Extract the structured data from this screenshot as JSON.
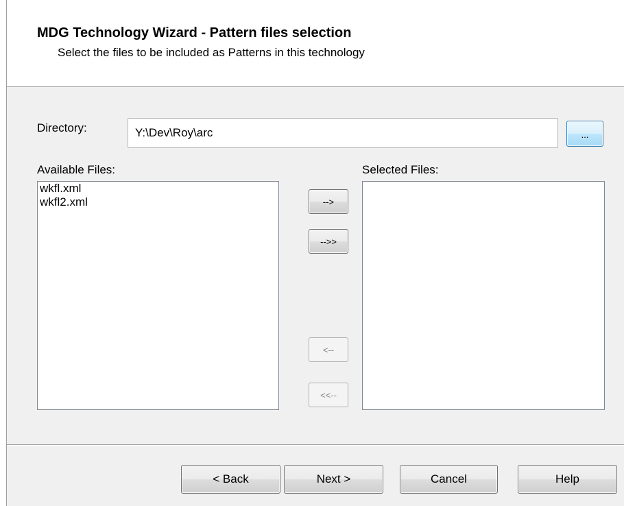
{
  "header": {
    "title": "MDG Technology Wizard - Pattern files selection",
    "subtitle": "Select the files to be included as Patterns in this technology"
  },
  "directory": {
    "label": "Directory:",
    "value": "Y:\\Dev\\Roy\\arc",
    "browse_label": "..."
  },
  "available": {
    "label": "Available Files:",
    "items": [
      "wkfl.xml",
      "wkfl2.xml"
    ]
  },
  "selected": {
    "label": "Selected Files:",
    "items": []
  },
  "move_buttons": {
    "add_one": "-->",
    "add_all": "-->>",
    "remove_one": "<--",
    "remove_all": "<<--"
  },
  "footer": {
    "back_label": "< Back",
    "next_label": "Next >",
    "cancel_label": "Cancel",
    "help_label": "Help"
  }
}
